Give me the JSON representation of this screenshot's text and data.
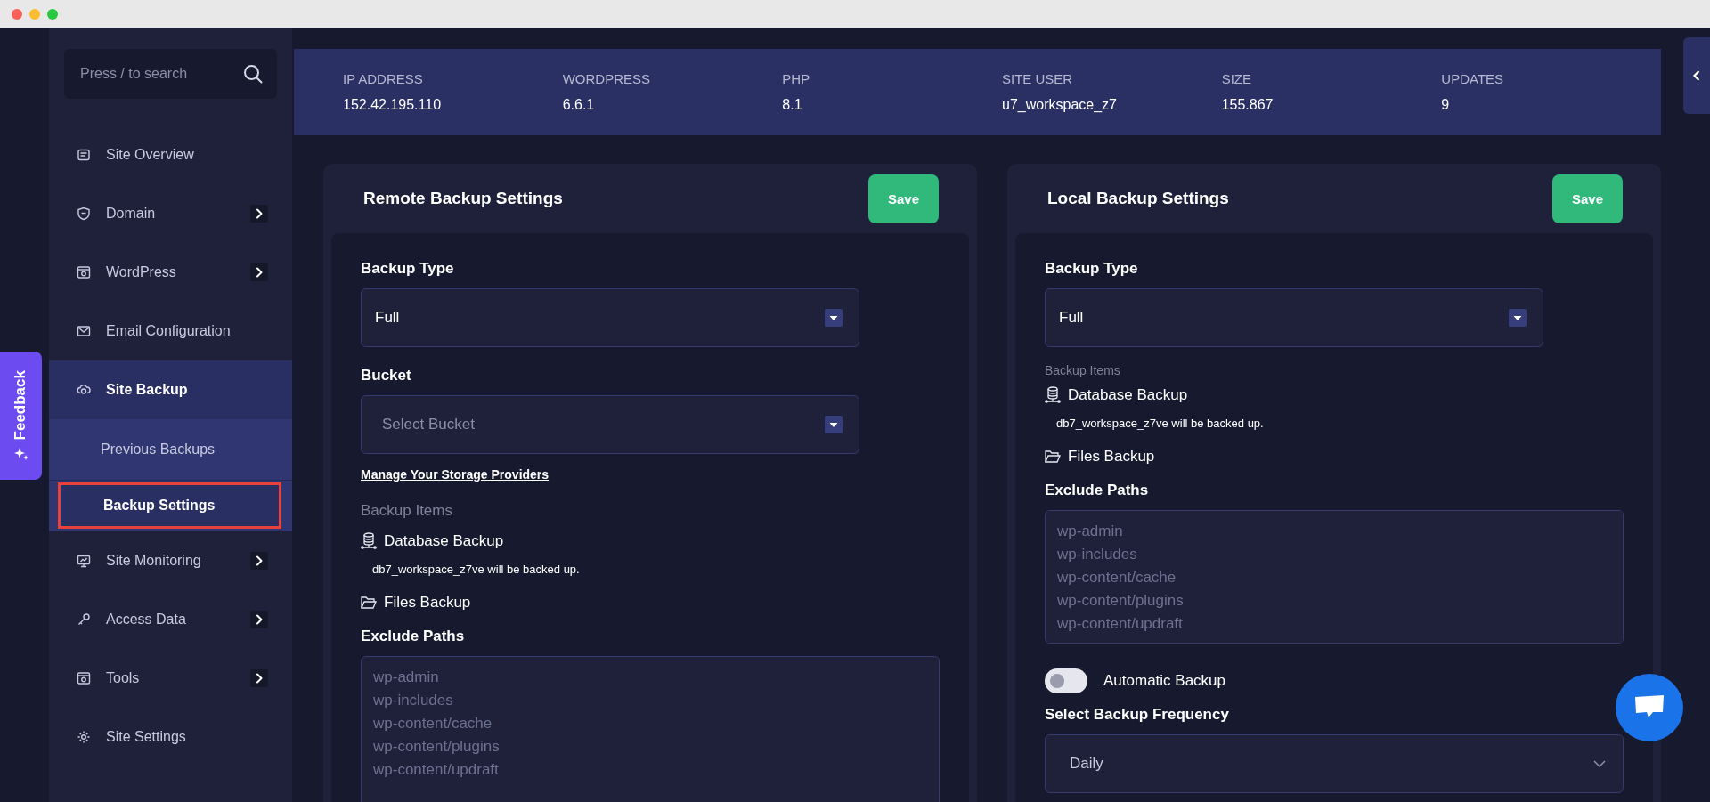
{
  "search": {
    "placeholder": "Press / to search"
  },
  "sidebar": {
    "items": [
      {
        "label": "Site Overview",
        "expandable": false,
        "selected": false
      },
      {
        "label": "Domain",
        "expandable": true,
        "selected": false
      },
      {
        "label": "WordPress",
        "expandable": true,
        "selected": false
      },
      {
        "label": "Email Configuration",
        "expandable": false,
        "selected": false
      },
      {
        "label": "Site Backup",
        "expandable": false,
        "selected": true,
        "children": [
          {
            "label": "Previous Backups",
            "selected": false
          },
          {
            "label": "Backup Settings",
            "selected": true
          }
        ]
      },
      {
        "label": "Site Monitoring",
        "expandable": true,
        "selected": false
      },
      {
        "label": "Access Data",
        "expandable": true,
        "selected": false
      },
      {
        "label": "Tools",
        "expandable": true,
        "selected": false
      },
      {
        "label": "Site Settings",
        "expandable": false,
        "selected": false
      }
    ]
  },
  "feedback_tab": "Feedback",
  "stats": [
    {
      "label": "IP ADDRESS",
      "value": "152.42.195.110"
    },
    {
      "label": "WORDPRESS",
      "value": "6.6.1"
    },
    {
      "label": "PHP",
      "value": "8.1"
    },
    {
      "label": "SITE USER",
      "value": "u7_workspace_z7"
    },
    {
      "label": "SIZE",
      "value": "155.867"
    },
    {
      "label": "UPDATES",
      "value": "9"
    }
  ],
  "remote": {
    "title": "Remote Backup Settings",
    "save": "Save",
    "backup_type_label": "Backup Type",
    "backup_type": "Full",
    "bucket_label": "Bucket",
    "bucket_placeholder": "Select Bucket",
    "manage_link": "Manage Your Storage Providers",
    "items_label": "Backup Items",
    "database_backup": "Database Backup",
    "database_note": "db7_workspace_z7ve will be backed up.",
    "files_backup": "Files Backup",
    "exclude_label": "Exclude Paths",
    "exclude_placeholder": [
      "wp-admin",
      "wp-includes",
      "wp-content/cache",
      "wp-content/plugins",
      "wp-content/updraft"
    ]
  },
  "local": {
    "title": "Local Backup Settings",
    "save": "Save",
    "backup_type_label": "Backup Type",
    "backup_type": "Full",
    "items_label": "Backup Items",
    "database_backup": "Database Backup",
    "database_note": "db7_workspace_z7ve will be backed up.",
    "files_backup": "Files Backup",
    "exclude_label": "Exclude Paths",
    "exclude_placeholder": [
      "wp-admin",
      "wp-includes",
      "wp-content/cache",
      "wp-content/plugins",
      "wp-content/updraft"
    ],
    "automatic_backup": {
      "label": "Automatic Backup",
      "on": false
    },
    "frequency_label": "Select Backup Frequency",
    "frequency": "Daily"
  }
}
